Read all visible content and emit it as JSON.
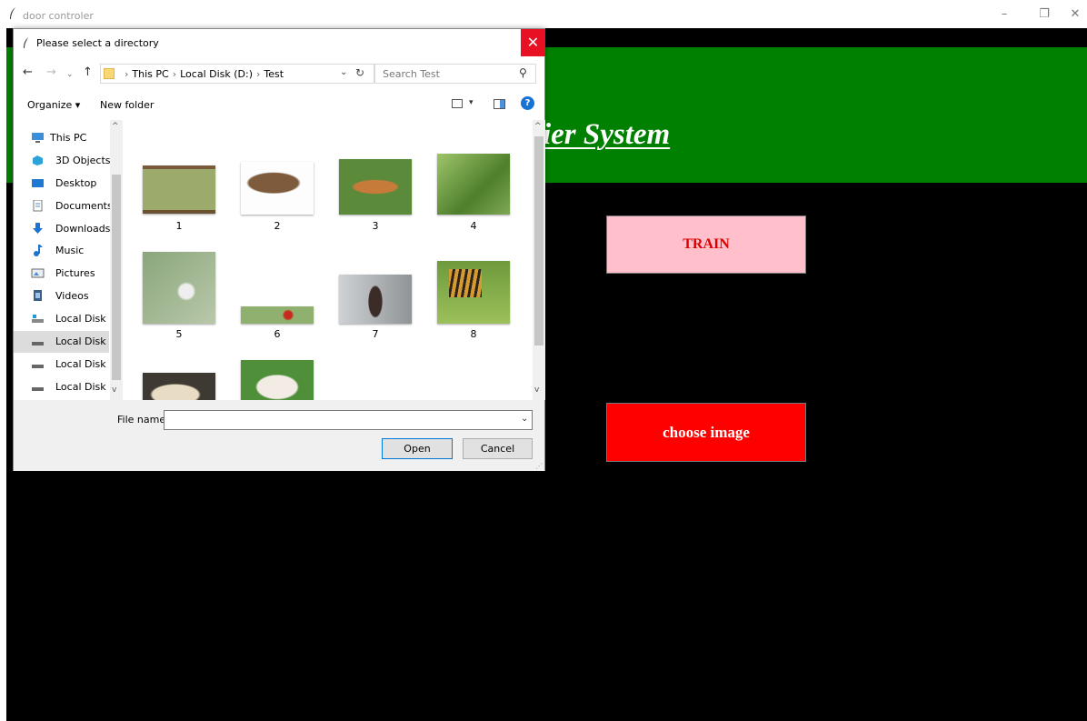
{
  "window": {
    "title": "door controler",
    "controls": {
      "minimize": "–",
      "restore": "❐",
      "close": "✕"
    }
  },
  "app": {
    "banner_title": "sed On Multiple Classifier System",
    "banner_color": "#008000",
    "train_label": "TRAIN",
    "choose_label": "choose image"
  },
  "dialog": {
    "title": "Please select a directory",
    "close": "✕",
    "nav": {
      "back": "←",
      "forward": "→",
      "recent": "⌄",
      "up": "↑",
      "dropdown": "⌄",
      "refresh": "↻"
    },
    "breadcrumb": [
      "This PC",
      "Local Disk (D:)",
      "Test"
    ],
    "breadcrumb_sep": "›",
    "search_placeholder": "Search Test",
    "search_glyph": "⚲",
    "toolbar": {
      "organize": "Organize ▾",
      "new_folder": "New folder",
      "view_dropdown": "▾",
      "help": "?"
    },
    "nav_items": [
      {
        "label": "This PC",
        "icon": "computer-icon"
      },
      {
        "label": "3D Objects",
        "icon": "cube-icon"
      },
      {
        "label": "Desktop",
        "icon": "desktop-icon"
      },
      {
        "label": "Documents",
        "icon": "document-icon"
      },
      {
        "label": "Downloads",
        "icon": "download-icon"
      },
      {
        "label": "Music",
        "icon": "music-icon"
      },
      {
        "label": "Pictures",
        "icon": "pictures-icon"
      },
      {
        "label": "Videos",
        "icon": "video-icon"
      },
      {
        "label": "Local Disk (C",
        "icon": "drive-icon"
      },
      {
        "label": "Local Disk (D",
        "icon": "drive-icon",
        "selected": true
      },
      {
        "label": "Local Disk (E",
        "icon": "drive-icon"
      },
      {
        "label": "Local Disk (F",
        "icon": "drive-icon"
      }
    ],
    "files": [
      "1",
      "2",
      "3",
      "4",
      "5",
      "6",
      "7",
      "8",
      "",
      ""
    ],
    "scroll_arrows": {
      "up": "^",
      "down": "v"
    },
    "file_name_label": "File name:",
    "file_name_value": "",
    "file_name_dropdown": "⌄",
    "open_label": "Open",
    "cancel_label": "Cancel",
    "resize_grip": "⋰"
  }
}
